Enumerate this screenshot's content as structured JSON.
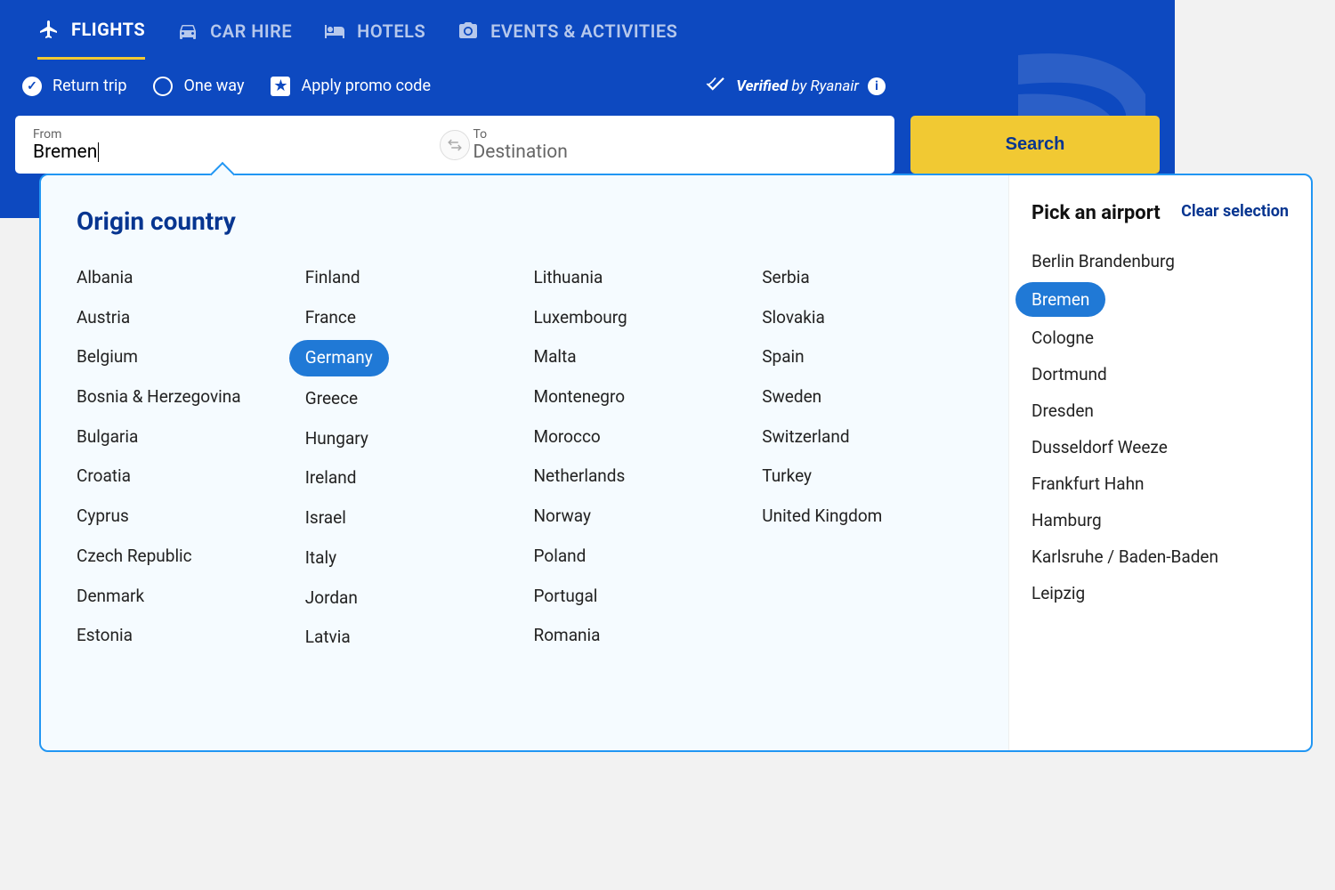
{
  "tabs": [
    {
      "label": "FLIGHTS",
      "active": true,
      "icon": "plane"
    },
    {
      "label": "CAR HIRE",
      "active": false,
      "icon": "car"
    },
    {
      "label": "HOTELS",
      "active": false,
      "icon": "bed"
    },
    {
      "label": "EVENTS & ACTIVITIES",
      "active": false,
      "icon": "camera"
    }
  ],
  "options": {
    "return_trip": "Return trip",
    "one_way": "One way",
    "promo": "Apply promo code",
    "verified_bold": "Verified",
    "verified_rest": " by Ryanair"
  },
  "search": {
    "from_label": "From",
    "from_value": "Bremen",
    "to_label": "To",
    "to_placeholder": "Destination",
    "button": "Search"
  },
  "dropdown": {
    "title": "Origin country",
    "selected_country": "Germany",
    "columns": [
      [
        "Albania",
        "Austria",
        "Belgium",
        "Bosnia & Herzegovina",
        "Bulgaria",
        "Croatia",
        "Cyprus",
        "Czech Republic",
        "Denmark",
        "Estonia"
      ],
      [
        "Finland",
        "France",
        "Germany",
        "Greece",
        "Hungary",
        "Ireland",
        "Israel",
        "Italy",
        "Jordan",
        "Latvia"
      ],
      [
        "Lithuania",
        "Luxembourg",
        "Malta",
        "Montenegro",
        "Morocco",
        "Netherlands",
        "Norway",
        "Poland",
        "Portugal",
        "Romania"
      ],
      [
        "Serbia",
        "Slovakia",
        "Spain",
        "Sweden",
        "Switzerland",
        "Turkey",
        "United Kingdom"
      ]
    ],
    "airport_title": "Pick an airport",
    "clear": "Clear selection",
    "selected_airport": "Bremen",
    "airports": [
      "Berlin Brandenburg",
      "Bremen",
      "Cologne",
      "Dortmund",
      "Dresden",
      "Dusseldorf Weeze",
      "Frankfurt Hahn",
      "Hamburg",
      "Karlsruhe / Baden-Baden",
      "Leipzig"
    ]
  }
}
